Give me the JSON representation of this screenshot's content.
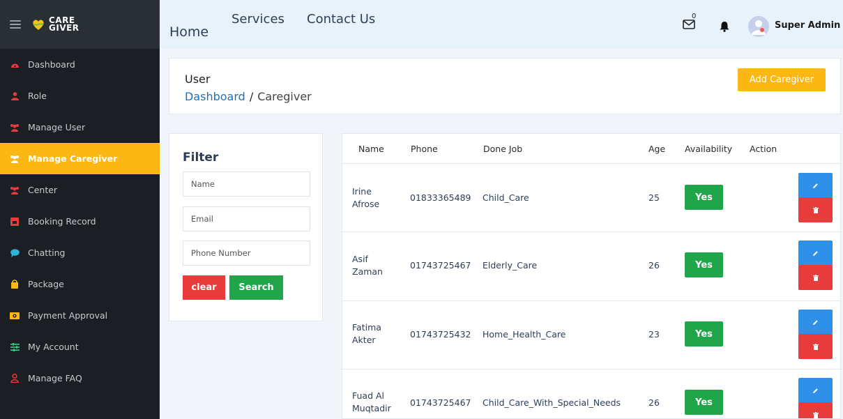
{
  "brand": {
    "line1": "CARE",
    "line2": "GIVER"
  },
  "sidebar": {
    "items": [
      {
        "label": "Dashboard",
        "icon": "dashboard-icon"
      },
      {
        "label": "Role",
        "icon": "user-icon"
      },
      {
        "label": "Manage User",
        "icon": "users-icon"
      },
      {
        "label": "Manage Caregiver",
        "icon": "users-icon",
        "active": true
      },
      {
        "label": "Center",
        "icon": "users-icon"
      },
      {
        "label": "Booking Record",
        "icon": "booking-icon"
      },
      {
        "label": "Chatting",
        "icon": "chat-icon"
      },
      {
        "label": "Package",
        "icon": "package-icon"
      },
      {
        "label": "Payment Approval",
        "icon": "money-icon"
      },
      {
        "label": "My Account",
        "icon": "sliders-icon"
      },
      {
        "label": "Manage FAQ",
        "icon": "faq-user-icon"
      }
    ]
  },
  "topnav": {
    "home": "Home",
    "services": "Services",
    "contact": "Contact Us"
  },
  "topbar": {
    "mail_count": "0",
    "admin_name": "Super Admin"
  },
  "header": {
    "title": "User",
    "breadcrumb_link": "Dashboard",
    "separator": "/",
    "breadcrumb_current": "Caregiver",
    "add_button": "Add Caregiver"
  },
  "filter": {
    "title": "Filter",
    "name_placeholder": "Name",
    "email_placeholder": "Email",
    "phone_placeholder": "Phone Number",
    "clear": "clear",
    "search": "Search"
  },
  "table": {
    "headers": [
      "Name",
      "Phone",
      "Done Job",
      "Age",
      "Availability",
      "Action"
    ],
    "rows": [
      {
        "name1": "Irine",
        "name2": "Afrose",
        "phone": "01833365489",
        "job": "Child_Care",
        "age": "25",
        "availability": "Yes"
      },
      {
        "name1": "Asif",
        "name2": "Zaman",
        "phone": "01743725467",
        "job": "Elderly_Care",
        "age": "26",
        "availability": "Yes"
      },
      {
        "name1": "Fatima",
        "name2": "Akter",
        "phone": "01743725432",
        "job": "Home_Health_Care",
        "age": "23",
        "availability": "Yes"
      },
      {
        "name1": "Fuad Al",
        "name2": "Muqtadir",
        "phone": "01743725467",
        "job": "Child_Care_With_Special_Needs",
        "age": "26",
        "availability": "Yes"
      }
    ]
  },
  "colors": {
    "accent": "#fbb814",
    "sidebar_bg": "#1b1e22",
    "success": "#21a54a",
    "danger": "#e83b3b",
    "primary": "#2e90e8",
    "link": "#1f6fb8"
  }
}
